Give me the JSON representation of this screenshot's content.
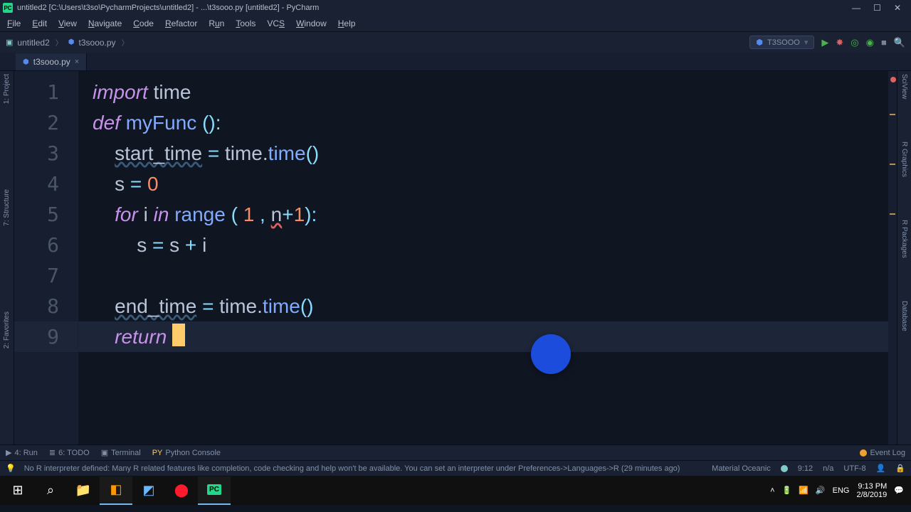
{
  "title": "untitled2 [C:\\Users\\t3so\\PycharmProjects\\untitled2] - ...\\t3sooo.py [untitled2] - PyCharm",
  "menu": [
    "File",
    "Edit",
    "View",
    "Navigate",
    "Code",
    "Refactor",
    "Run",
    "Tools",
    "VCS",
    "Window",
    "Help"
  ],
  "crumbs": {
    "project": "untitled2",
    "file": "t3sooo.py"
  },
  "run_config": "T3SOOO",
  "tab": {
    "name": "t3sooo.py"
  },
  "lines": [
    "1",
    "2",
    "3",
    "4",
    "5",
    "6",
    "7",
    "8",
    "9"
  ],
  "code": {
    "l1": {
      "kw": "import",
      "sp": " ",
      "mod": "time"
    },
    "l2": {
      "kw": "def",
      "sp": " ",
      "fn": "myFunc ",
      "p": "():"
    },
    "l3": {
      "indent": "    ",
      "var": "start_time",
      "sp": " = ",
      "mod": "time.",
      "fn": "time",
      "p": "()"
    },
    "l4": {
      "indent": "    ",
      "var": "s",
      "sp": " = ",
      "num": "0"
    },
    "l5": {
      "indent": "    ",
      "kw": "for",
      "sp": " ",
      "var": "i",
      "sp2": " ",
      "kw2": "in",
      "sp3": " ",
      "fn": "range",
      "sp4": " ( ",
      "num": "1",
      "sp5": " , ",
      "err": "n",
      "op": "+",
      "num2": "1",
      "p": "):"
    },
    "l6": {
      "indent": "        ",
      "var": "s",
      "sp": " = ",
      "var2": "s",
      "sp2": " + ",
      "var3": "i"
    },
    "l8": {
      "indent": "    ",
      "var": "end_time",
      "sp": " = ",
      "mod": "time.",
      "fn": "time",
      "p": "()"
    },
    "l9": {
      "indent": "    ",
      "kw": "return",
      "sp": " "
    }
  },
  "leftrail": [
    "1: Project",
    "7: Structure",
    "2: Favorites"
  ],
  "rightrail": [
    "SciView",
    "R Graphics",
    "R Packages",
    "Database"
  ],
  "bottom": {
    "run": "4: Run",
    "todo": "6: TODO",
    "terminal": "Terminal",
    "pyconsole": "Python Console",
    "event": "Event Log"
  },
  "status": {
    "msg": "No R interpreter defined: Many R related features like completion, code checking and help won't be available. You can set an interpreter under Preferences->Languages->R (29 minutes ago)",
    "theme": "Material Oceanic",
    "pos": "9:12",
    "cols": "n/a",
    "enc": "UTF-8",
    "insp": ""
  },
  "sys": {
    "lang": "ENG",
    "time": "9:13 PM",
    "date": "2/8/2019"
  }
}
